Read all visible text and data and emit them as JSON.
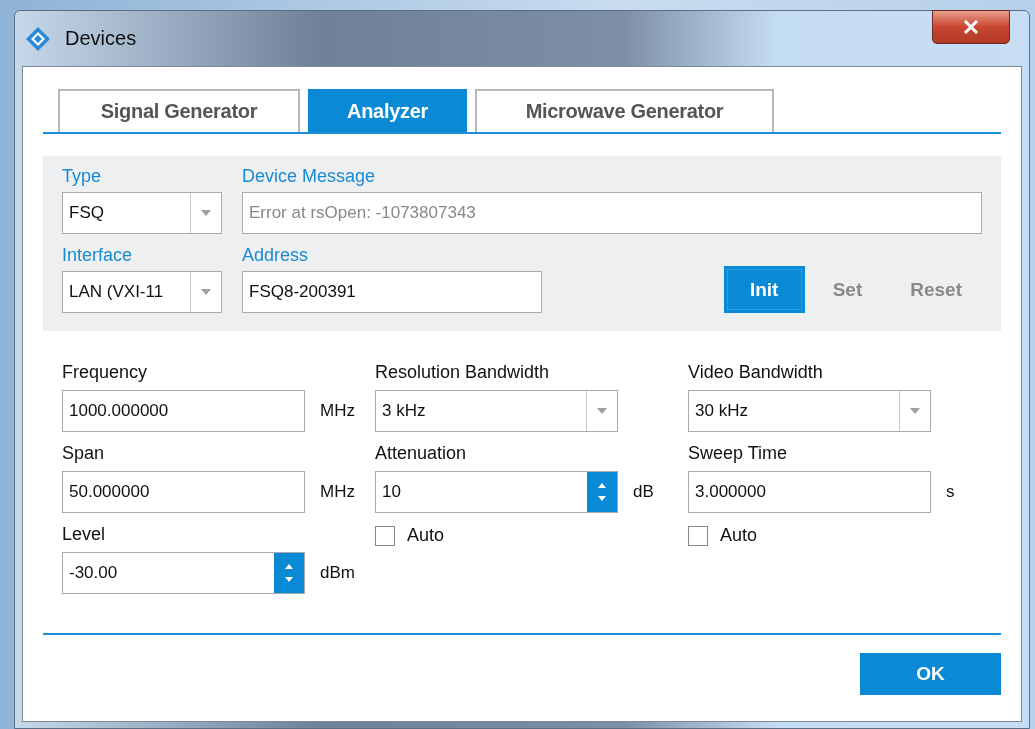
{
  "window": {
    "title": "Devices"
  },
  "tabs": [
    {
      "label": "Signal Generator",
      "selected": false
    },
    {
      "label": "Analyzer",
      "selected": true
    },
    {
      "label": "Microwave Generator",
      "selected": false
    }
  ],
  "connection": {
    "type": {
      "label": "Type",
      "value": "FSQ"
    },
    "device_message": {
      "label": "Device Message",
      "value": "Error at rsOpen: -1073807343",
      "disabled": true
    },
    "interface": {
      "label": "Interface",
      "value": "LAN (VXI-11"
    },
    "address": {
      "label": "Address",
      "value": "FSQ8-200391"
    },
    "buttons": [
      {
        "label": "Init",
        "disabled": false,
        "focused": true
      },
      {
        "label": "Set",
        "disabled": true,
        "focused": false
      },
      {
        "label": "Reset",
        "disabled": true,
        "focused": false
      }
    ]
  },
  "parameters": [
    [
      {
        "kind": "text",
        "label": "Frequency",
        "value": "1000.000000",
        "unit": "MHz"
      },
      {
        "kind": "text",
        "label": "Span",
        "value": "50.000000",
        "unit": "MHz"
      },
      {
        "kind": "spin",
        "label": "Level",
        "value": "-30.00",
        "unit": "dBm"
      }
    ],
    [
      {
        "kind": "dropdown",
        "label": "Resolution Bandwidth",
        "value": "3 kHz"
      },
      {
        "kind": "spin",
        "label": "Attenuation",
        "value": "10",
        "unit": "dB"
      },
      {
        "kind": "checkbox",
        "label": "Auto",
        "checked": false
      }
    ],
    [
      {
        "kind": "dropdown",
        "label": "Video Bandwidth",
        "value": "30 kHz"
      },
      {
        "kind": "text",
        "label": "Sweep Time",
        "value": "3.000000",
        "unit": "s"
      },
      {
        "kind": "checkbox",
        "label": "Auto",
        "checked": false
      }
    ]
  ],
  "ok_button": "OK"
}
